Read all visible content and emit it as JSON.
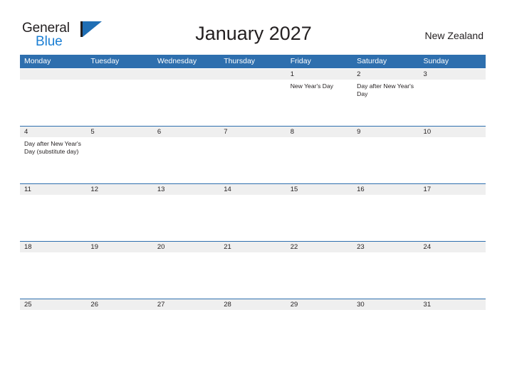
{
  "brand": {
    "name_part1": "General",
    "name_part2": "Blue",
    "mark_icon": "triangle-flag-icon",
    "accent_color": "#1f6eb4",
    "text_color": "#1b7fd4"
  },
  "header": {
    "title": "January 2027",
    "region": "New Zealand"
  },
  "colors": {
    "header_blue": "#2e6fae",
    "band_gray": "#efefef",
    "text": "#231f20"
  },
  "calendar": {
    "weekdays": [
      "Monday",
      "Tuesday",
      "Wednesday",
      "Thursday",
      "Friday",
      "Saturday",
      "Sunday"
    ],
    "weeks": [
      {
        "days": [
          {
            "number": "",
            "events": []
          },
          {
            "number": "",
            "events": []
          },
          {
            "number": "",
            "events": []
          },
          {
            "number": "",
            "events": []
          },
          {
            "number": "1",
            "events": [
              "New Year's Day"
            ]
          },
          {
            "number": "2",
            "events": [
              "Day after New Year's Day"
            ]
          },
          {
            "number": "3",
            "events": []
          }
        ]
      },
      {
        "days": [
          {
            "number": "4",
            "events": [
              "Day after New Year's Day (substitute day)"
            ]
          },
          {
            "number": "5",
            "events": []
          },
          {
            "number": "6",
            "events": []
          },
          {
            "number": "7",
            "events": []
          },
          {
            "number": "8",
            "events": []
          },
          {
            "number": "9",
            "events": []
          },
          {
            "number": "10",
            "events": []
          }
        ]
      },
      {
        "days": [
          {
            "number": "11",
            "events": []
          },
          {
            "number": "12",
            "events": []
          },
          {
            "number": "13",
            "events": []
          },
          {
            "number": "14",
            "events": []
          },
          {
            "number": "15",
            "events": []
          },
          {
            "number": "16",
            "events": []
          },
          {
            "number": "17",
            "events": []
          }
        ]
      },
      {
        "days": [
          {
            "number": "18",
            "events": []
          },
          {
            "number": "19",
            "events": []
          },
          {
            "number": "20",
            "events": []
          },
          {
            "number": "21",
            "events": []
          },
          {
            "number": "22",
            "events": []
          },
          {
            "number": "23",
            "events": []
          },
          {
            "number": "24",
            "events": []
          }
        ]
      },
      {
        "days": [
          {
            "number": "25",
            "events": []
          },
          {
            "number": "26",
            "events": []
          },
          {
            "number": "27",
            "events": []
          },
          {
            "number": "28",
            "events": []
          },
          {
            "number": "29",
            "events": []
          },
          {
            "number": "30",
            "events": []
          },
          {
            "number": "31",
            "events": []
          }
        ]
      }
    ]
  }
}
